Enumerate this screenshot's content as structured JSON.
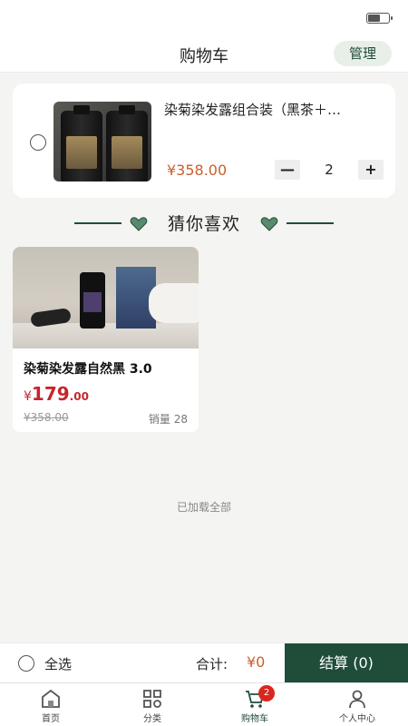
{
  "status_bar": {
    "battery_level": 0.6
  },
  "header": {
    "title": "购物车",
    "manage_label": "管理"
  },
  "cart": {
    "items": [
      {
        "name": "染菊染发露组合装（黑茶＋…",
        "price": "¥358.00",
        "quantity": "2",
        "minus_symbol": "—",
        "plus_symbol": "+"
      }
    ]
  },
  "recommend": {
    "title": "猜你喜欢",
    "products": [
      {
        "name": "染菊染发露自然黑 3.0",
        "price_currency": "¥",
        "price_int": "179",
        "price_dec": ".00",
        "original_price": "¥358.00",
        "sales_label": "销量",
        "sales_count": "28"
      }
    ],
    "loaded_all": "已加载全部"
  },
  "checkout": {
    "select_all": "全选",
    "total_label": "合计:",
    "total_value": "¥0",
    "checkout_label": "结算 (0)"
  },
  "tabbar": {
    "tabs": [
      {
        "label": "首页",
        "icon": "home-icon"
      },
      {
        "label": "分类",
        "icon": "category-icon"
      },
      {
        "label": "购物车",
        "icon": "cart-icon",
        "badge": "2"
      },
      {
        "label": "个人中心",
        "icon": "person-icon"
      }
    ]
  },
  "colors": {
    "brand": "#1f4d3a",
    "price": "#c8602c",
    "sale_price": "#c4272c",
    "badge": "#d9271f"
  }
}
